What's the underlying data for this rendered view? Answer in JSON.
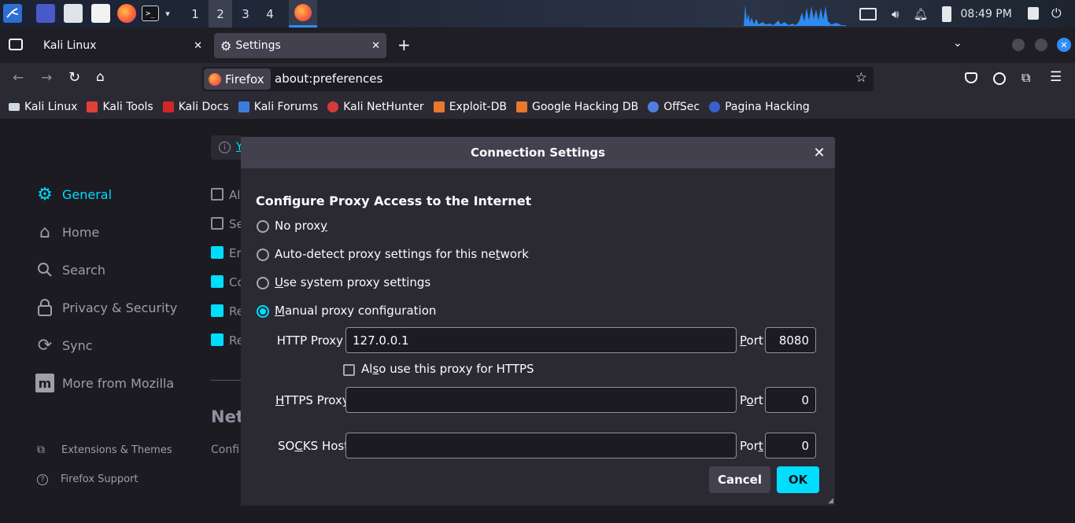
{
  "taskbar": {
    "workspaces": [
      "1",
      "2",
      "3",
      "4"
    ],
    "active_workspace": "2",
    "clock": "08:49 PM"
  },
  "tabs": [
    {
      "label": "Kali Linux",
      "active": false
    },
    {
      "label": "Settings",
      "active": true
    }
  ],
  "navbar": {
    "identity_label": "Firefox",
    "url": "about:preferences"
  },
  "bookmarks": [
    {
      "label": "Kali Linux",
      "color": "#cfd8e3"
    },
    {
      "label": "Kali Tools",
      "color": "#e0413b"
    },
    {
      "label": "Kali Docs",
      "color": "#d02828"
    },
    {
      "label": "Kali Forums",
      "color": "#3b7ddd"
    },
    {
      "label": "Kali NetHunter",
      "color": "#d43a3a"
    },
    {
      "label": "Exploit-DB",
      "color": "#e8792c"
    },
    {
      "label": "Google Hacking DB",
      "color": "#e8792c"
    },
    {
      "label": "OffSec",
      "color": "#4f7fe0"
    },
    {
      "label": "Pagina Hacking",
      "color": "#3b5fc9"
    }
  ],
  "sidebar": {
    "items": [
      {
        "label": "General",
        "icon": "gear-icon",
        "selected": true
      },
      {
        "label": "Home",
        "icon": "home-icon",
        "selected": false
      },
      {
        "label": "Search",
        "icon": "search-icon",
        "selected": false
      },
      {
        "label": "Privacy & Security",
        "icon": "lock-icon",
        "selected": false
      },
      {
        "label": "Sync",
        "icon": "sync-icon",
        "selected": false
      },
      {
        "label": "More from Mozilla",
        "icon": "mozilla-icon",
        "selected": false
      }
    ],
    "footer": [
      {
        "label": "Extensions & Themes",
        "icon": "puzzle-icon"
      },
      {
        "label": "Firefox Support",
        "icon": "help-icon"
      }
    ]
  },
  "background_page": {
    "fragments": [
      "Al",
      "Se",
      "Er",
      "Co",
      "Re",
      "Re"
    ],
    "checked": [
      false,
      false,
      true,
      true,
      true,
      true
    ],
    "heading_fragment": "Net",
    "text_fragment": "Confi",
    "info_fragment": "Y"
  },
  "dialog": {
    "title": "Connection Settings",
    "heading": "Configure Proxy Access to the Internet",
    "options": [
      {
        "label": "No proxy",
        "selected": false
      },
      {
        "label": "Auto-detect proxy settings for this network",
        "selected": false
      },
      {
        "label": "Use system proxy settings",
        "selected": false
      },
      {
        "label": "Manual proxy configuration",
        "selected": true
      }
    ],
    "http_proxy": {
      "label": "HTTP Proxy",
      "value": "127.0.0.1",
      "port_label": "Port",
      "port": "8080"
    },
    "also_https": {
      "label": "Also use this proxy for HTTPS",
      "checked": false
    },
    "https_proxy": {
      "label": "HTTPS Proxy",
      "value": "",
      "port_label": "Port",
      "port": "0"
    },
    "socks_host": {
      "label": "SOCKS Host",
      "value": "",
      "port_label": "Port",
      "port": "0"
    },
    "cancel_label": "Cancel",
    "ok_label": "OK"
  },
  "colors": {
    "accent": "#00ddff",
    "dialog_bg": "#2b2a33",
    "field_bg": "#1c1b22"
  }
}
